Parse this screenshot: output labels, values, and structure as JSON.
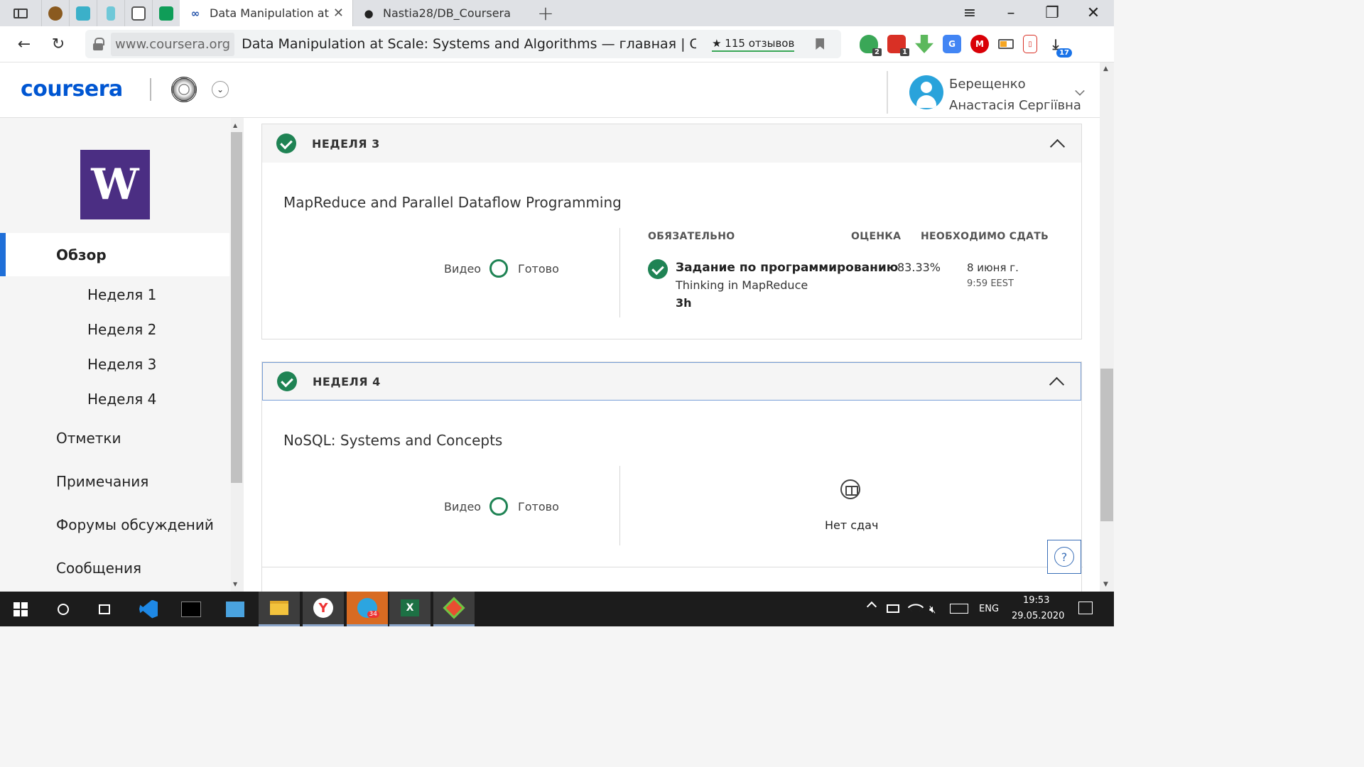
{
  "browser": {
    "active_tab_title": "Data Manipulation at Scale",
    "github_tab_title": "Nastia28/DB_Coursera",
    "new_tab_symbol": "+",
    "host": "www.coursera.org",
    "page_title": "Data Manipulation at Scale: Systems and Algorithms — главная | Cour...",
    "reviews": "★ 115 отзывов",
    "ext_badges": {
      "shield": "2",
      "mail": "1",
      "downloads": "17"
    }
  },
  "header": {
    "logo": "coursera",
    "user_name_line1": "Берещенко",
    "user_name_line2": "Анастасія Сергіївна"
  },
  "sidebar": {
    "uw_letter": "W",
    "active_item": "Обзор",
    "weeks": [
      "Неделя 1",
      "Неделя 2",
      "Неделя 3",
      "Неделя 4"
    ],
    "items": [
      "Отметки",
      "Примечания",
      "Форумы обсуждений",
      "Сообщения"
    ]
  },
  "weeks": [
    {
      "label": "НЕДЕЛЯ 3",
      "module_title": "MapReduce and Parallel Dataflow Programming",
      "video_label": "Видео",
      "done_label": "Готово",
      "col_required": "ОБЯЗАТЕЛЬНО",
      "col_grade": "ОЦЕНКА",
      "col_due": "НЕОБХОДИМО СДАТЬ",
      "task": {
        "type": "Задание по программированию",
        "name": "Thinking in MapReduce",
        "duration": "3h",
        "grade": "83.33%",
        "due_date": "8 июня г.",
        "due_time": "9:59 EEST"
      }
    },
    {
      "label": "НЕДЕЛЯ 4",
      "module_title": "NoSQL: Systems and Concepts",
      "video_label": "Видео",
      "done_label": "Готово",
      "no_submissions": "Нет сдач"
    }
  ],
  "help": "?",
  "taskbar": {
    "telegram_badge": "34",
    "language": "ENG",
    "time": "19:53",
    "date": "29.05.2020"
  }
}
